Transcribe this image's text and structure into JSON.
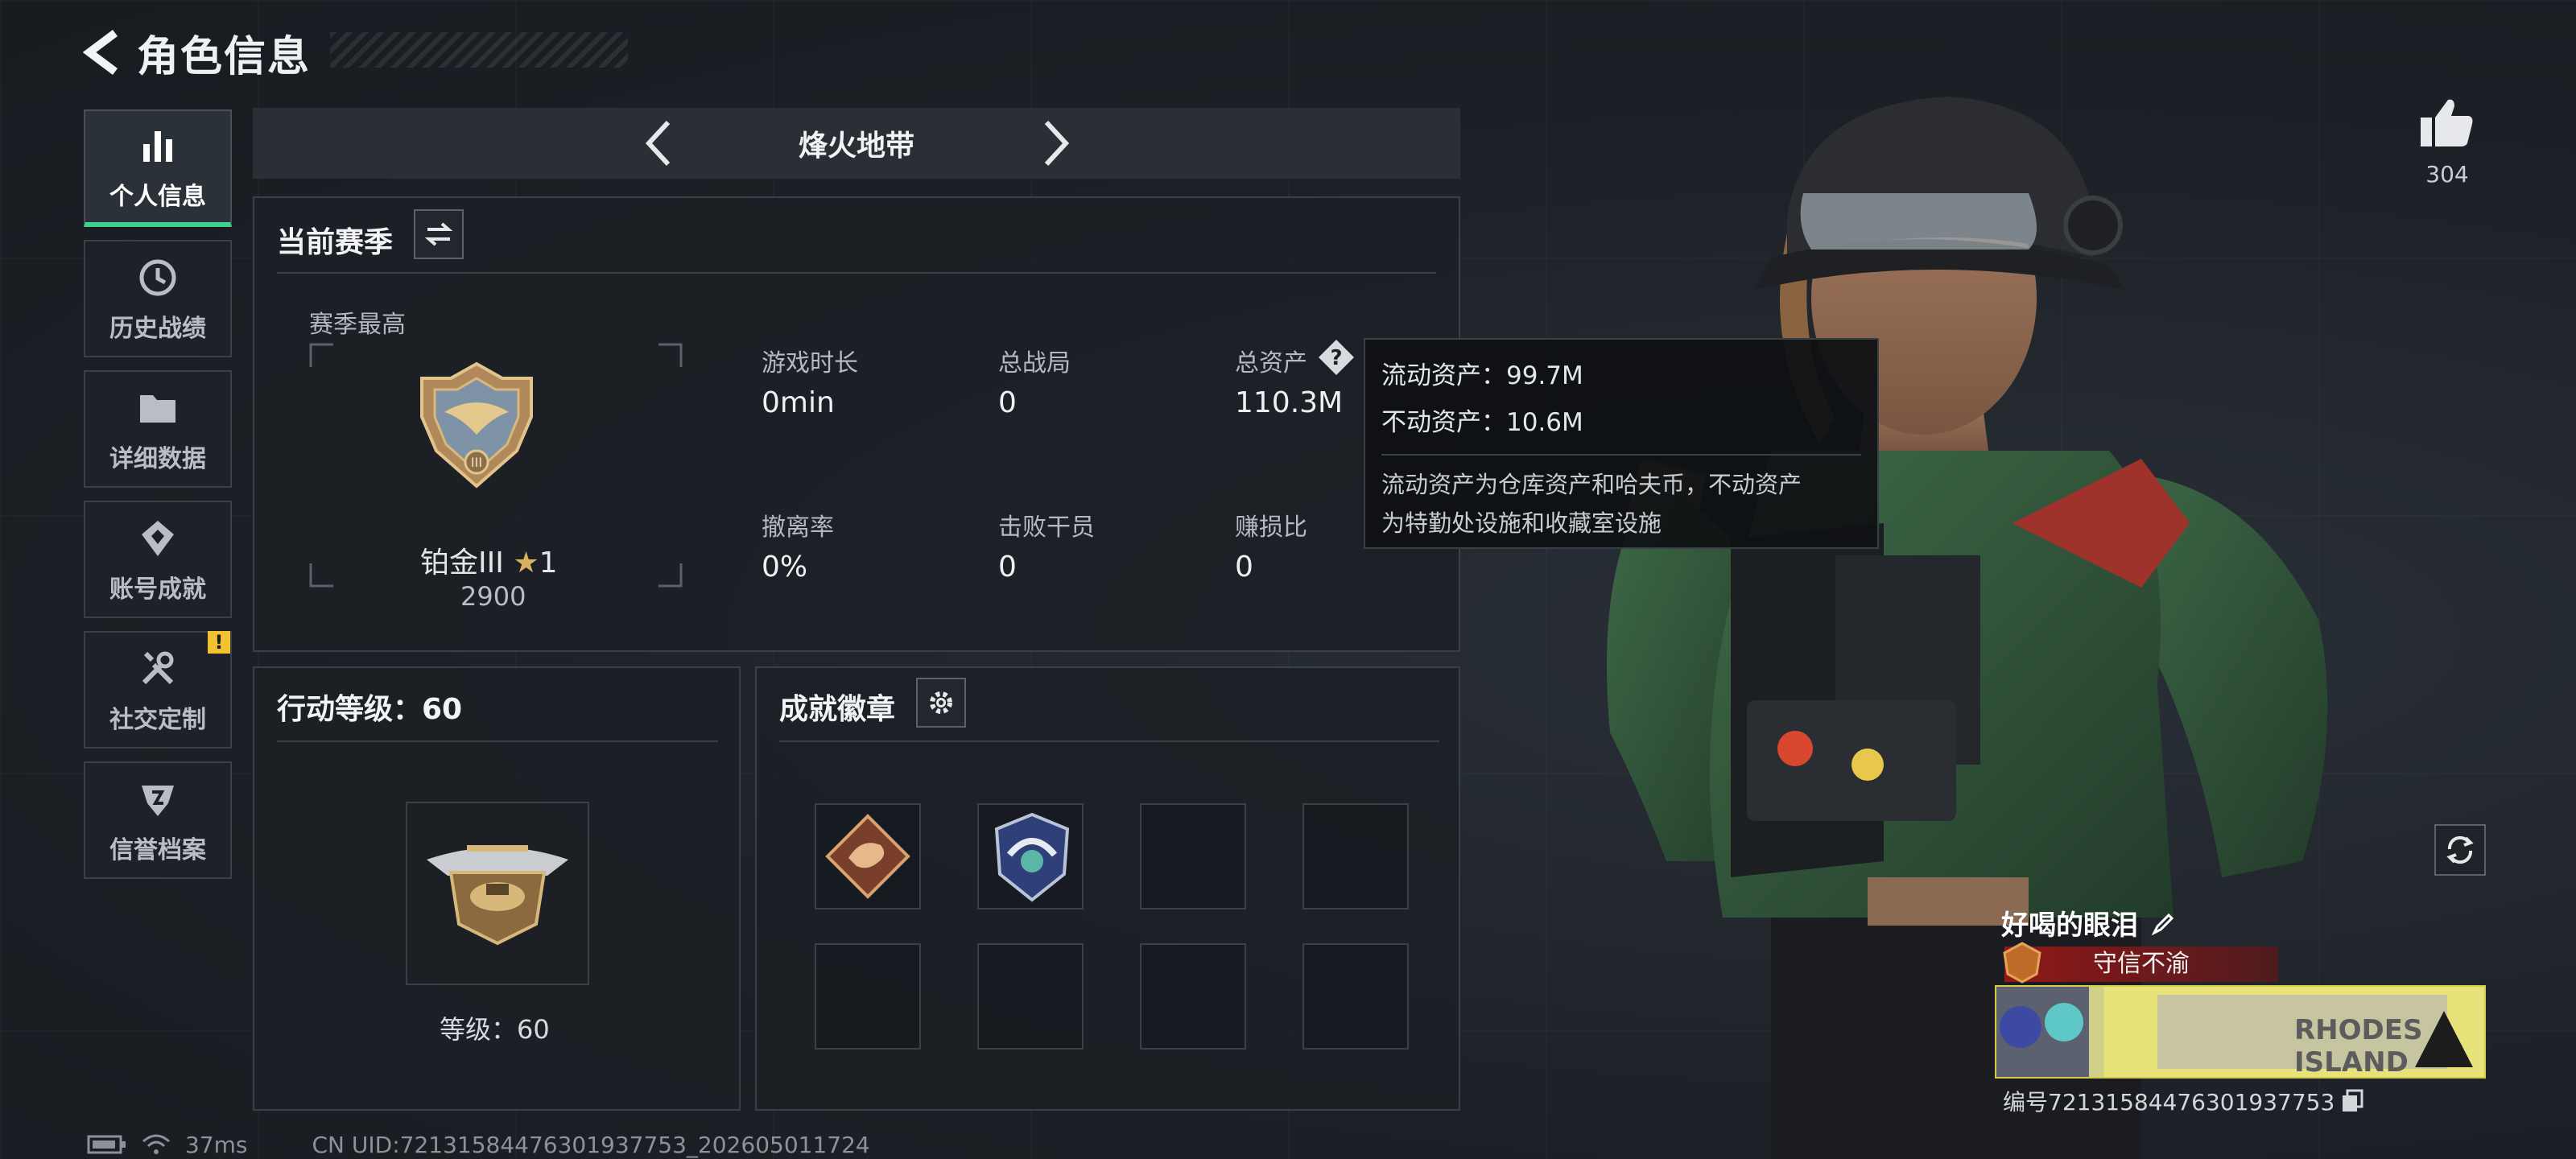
{
  "header": {
    "title": "角色信息"
  },
  "sidebar": {
    "items": [
      {
        "label": "个人信息",
        "icon": "bar-chart-icon",
        "active": true
      },
      {
        "label": "历史战绩",
        "icon": "clock-icon"
      },
      {
        "label": "详细数据",
        "icon": "folder-icon"
      },
      {
        "label": "账号成就",
        "icon": "achievement-icon"
      },
      {
        "label": "社交定制",
        "icon": "tools-icon",
        "alert": "!"
      },
      {
        "label": "信誉档案",
        "icon": "shield-icon"
      }
    ]
  },
  "mode": {
    "title": "烽火地带"
  },
  "season": {
    "title": "当前赛季",
    "best_label": "赛季最高",
    "rank_name": "铂金III",
    "rank_stars": "1",
    "rank_score": "2900",
    "stats": [
      {
        "label": "游戏时长",
        "value": "0min"
      },
      {
        "label": "总战局",
        "value": "0"
      },
      {
        "label": "总资产",
        "value": "110.3M"
      },
      {
        "label": "撤离率",
        "value": "0%"
      },
      {
        "label": "击败干员",
        "value": "0"
      },
      {
        "label": "赚损比",
        "value": "0"
      }
    ]
  },
  "tooltip": {
    "liquid": "流动资产：99.7M",
    "fixed": "不动资产：10.6M",
    "desc_line1": "流动资产为仓库资产和哈夫币，不动资产",
    "desc_line2": "为特勤处设施和收藏室设施"
  },
  "action_level": {
    "title": "行动等级：60",
    "level_text": "等级：60"
  },
  "badges": {
    "title": "成就徽章",
    "slots": [
      "dragon-badge",
      "eagle-badge",
      "",
      "",
      "",
      "",
      "",
      ""
    ]
  },
  "profile": {
    "likes": "304",
    "player_name": "好喝的眼泪",
    "player_title": "守信不渝",
    "player_id": "编号7213158447630193775​3",
    "card_text": "RHODES ISLAND"
  },
  "footer": {
    "ping": "37ms",
    "uid": "CN UID:72131584476301937753_202605011724"
  },
  "colors": {
    "accent": "#3ecf8e",
    "alert": "#f2c230",
    "title_red": "#961919"
  }
}
